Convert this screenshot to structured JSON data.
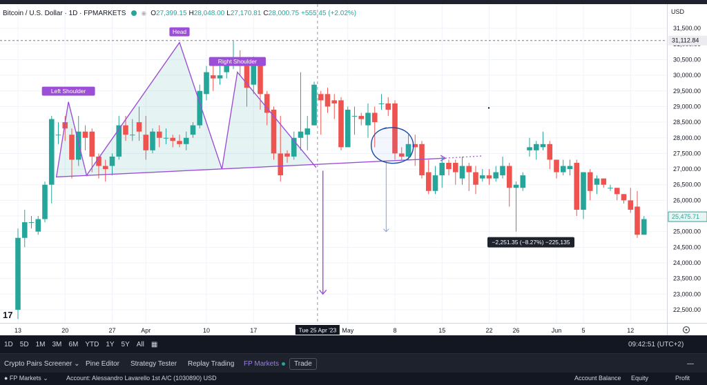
{
  "legend": {
    "symbol": "Bitcoin / U.S. Dollar · 1D · FPMARKETS",
    "open_label": "O",
    "open": "27,399.15",
    "high_label": "H",
    "high": "28,048.00",
    "low_label": "L",
    "low": "27,170.81",
    "close_label": "C",
    "close": "28,000.75",
    "change": "+555.45 (+2.02%)"
  },
  "currency": "USD",
  "price_badges": {
    "line_price": "31,112.84",
    "last_price": "25,475.71"
  },
  "measure_label": "−2,251.35 (−8.27%) −225,135",
  "crosshair_date": "Tue 25 Apr '23",
  "tv_logo": "17",
  "colors": {
    "up": "#26a69a",
    "down": "#ef5350",
    "pattern": "#9c4fd6",
    "circle": "#1848a8"
  },
  "chart_data": {
    "type": "candlestick",
    "title": "Bitcoin / U.S. Dollar · 1D · FPMARKETS",
    "y_ticks": [
      22500,
      23000,
      23500,
      24000,
      24500,
      25000,
      25500,
      26000,
      26500,
      27000,
      27500,
      28000,
      28500,
      29000,
      29500,
      30000,
      30500,
      31000,
      31500
    ],
    "y_range": [
      22300,
      32100
    ],
    "x_tick_labels": [
      {
        "label": "13",
        "i": 0
      },
      {
        "label": "20",
        "i": 7
      },
      {
        "label": "27",
        "i": 14
      },
      {
        "label": "Apr",
        "i": 19
      },
      {
        "label": "10",
        "i": 28
      },
      {
        "label": "17",
        "i": 35
      },
      {
        "label": "May",
        "i": 49
      },
      {
        "label": "8",
        "i": 56
      },
      {
        "label": "15",
        "i": 63
      },
      {
        "label": "22",
        "i": 70
      },
      {
        "label": "26",
        "i": 74
      },
      {
        "label": "Jun",
        "i": 80
      },
      {
        "label": "5",
        "i": 84
      },
      {
        "label": "12",
        "i": 91
      }
    ],
    "candles": [
      [
        22500,
        24800,
        22200,
        25100
      ],
      [
        24800,
        25300,
        24500,
        25700
      ],
      [
        25300,
        25300,
        25100,
        25500
      ],
      [
        25000,
        25400,
        24900,
        25500
      ],
      [
        25400,
        26500,
        25300,
        26600
      ],
      [
        26500,
        28600,
        25900,
        28700
      ],
      [
        28100,
        28100,
        27800,
        28500
      ],
      [
        28500,
        28300,
        27900,
        28700
      ],
      [
        28100,
        27300,
        26700,
        28300
      ],
      [
        27300,
        28200,
        27100,
        28700
      ],
      [
        28200,
        28000,
        27600,
        28400
      ],
      [
        28200,
        27400,
        26900,
        28300
      ],
      [
        27400,
        27100,
        26700,
        27500
      ],
      [
        27100,
        27000,
        26600,
        27300
      ],
      [
        27100,
        27400,
        26800,
        27500
      ],
      [
        27400,
        28400,
        27300,
        28700
      ],
      [
        28400,
        28100,
        27900,
        28700
      ],
      [
        28100,
        28100,
        27900,
        28600
      ],
      [
        28500,
        28200,
        27900,
        29000
      ],
      [
        28100,
        27600,
        27300,
        28700
      ],
      [
        27600,
        28200,
        27500,
        28300
      ],
      [
        28200,
        28000,
        27700,
        28400
      ],
      [
        28000,
        28000,
        27800,
        28300
      ],
      [
        28000,
        27900,
        27700,
        28100
      ],
      [
        27900,
        27800,
        27700,
        28100
      ],
      [
        27800,
        28000,
        27600,
        28200
      ],
      [
        28100,
        28400,
        28000,
        28500
      ],
      [
        28400,
        29500,
        28300,
        29700
      ],
      [
        29400,
        30100,
        29200,
        30300
      ],
      [
        30000,
        29900,
        29500,
        30300
      ],
      [
        29900,
        30000,
        29700,
        30400
      ],
      [
        30100,
        30400,
        29900,
        30500
      ],
      [
        30400,
        30500,
        30200,
        31100
      ],
      [
        30500,
        30300,
        30000,
        30800
      ],
      [
        30300,
        29600,
        29000,
        30500
      ],
      [
        29700,
        30500,
        29400,
        30600
      ],
      [
        30400,
        29400,
        28900,
        30500
      ],
      [
        29400,
        28800,
        28400,
        29500
      ],
      [
        28900,
        27500,
        27300,
        29000
      ],
      [
        27500,
        26800,
        26600,
        28700
      ],
      [
        27500,
        27400,
        27200,
        27600
      ],
      [
        27400,
        28000,
        27300,
        28200
      ],
      [
        28000,
        28200,
        27600,
        30100
      ],
      [
        28100,
        28300,
        27600,
        28700
      ],
      [
        28400,
        29700,
        28400,
        29800
      ],
      [
        29400,
        29200,
        28100,
        29500
      ],
      [
        29400,
        29000,
        28800,
        29600
      ],
      [
        29200,
        29100,
        28600,
        29400
      ],
      [
        29200,
        27700,
        27600,
        29300
      ],
      [
        27700,
        28900,
        27700,
        29000
      ],
      [
        28700,
        28700,
        28100,
        29000
      ],
      [
        28700,
        28600,
        28400,
        28800
      ],
      [
        28400,
        28800,
        28000,
        29100
      ],
      [
        28800,
        28500,
        27700,
        29000
      ],
      [
        29100,
        29100,
        28900,
        29400
      ],
      [
        29100,
        28900,
        28700,
        29300
      ],
      [
        29100,
        27500,
        27300,
        29200
      ],
      [
        27500,
        27400,
        27300,
        27700
      ],
      [
        27400,
        27800,
        27300,
        28100
      ],
      [
        27800,
        27700,
        27100,
        28100
      ],
      [
        27800,
        26800,
        26700,
        27900
      ],
      [
        26900,
        26300,
        26200,
        27300
      ],
      [
        26300,
        26800,
        26200,
        27100
      ],
      [
        26800,
        27200,
        26400,
        27400
      ],
      [
        27200,
        27000,
        26800,
        27300
      ],
      [
        27200,
        26900,
        26500,
        27300
      ],
      [
        26700,
        27100,
        26500,
        27400
      ],
      [
        27100,
        26900,
        26300,
        27200
      ],
      [
        26900,
        26500,
        26200,
        27100
      ],
      [
        26700,
        26800,
        26600,
        27000
      ],
      [
        26800,
        26700,
        26500,
        27000
      ],
      [
        26700,
        26900,
        26600,
        27100
      ],
      [
        26800,
        27100,
        26700,
        27400
      ],
      [
        27100,
        26400,
        25800,
        27200
      ],
      [
        26400,
        26500,
        25000,
        26600
      ],
      [
        26400,
        26800,
        26300,
        26900
      ],
      [
        27600,
        27700,
        27400,
        28000
      ],
      [
        27600,
        27800,
        27300,
        27900
      ],
      [
        27700,
        27800,
        27600,
        28200
      ],
      [
        27800,
        27300,
        27000,
        27900
      ],
      [
        27300,
        26900,
        26700,
        27000
      ],
      [
        26900,
        27100,
        26800,
        27300
      ],
      [
        27000,
        27100,
        26800,
        27300
      ],
      [
        27200,
        25700,
        25500,
        27300
      ],
      [
        25700,
        26900,
        25400,
        26900
      ],
      [
        26900,
        26300,
        26000,
        27000
      ],
      [
        26500,
        26700,
        26200,
        26800
      ],
      [
        26700,
        26500,
        26400,
        26700
      ],
      [
        26400,
        26400,
        26300,
        26500
      ],
      [
        26400,
        26200,
        26000,
        26400
      ],
      [
        26200,
        26000,
        25900,
        26200
      ],
      [
        26000,
        25700,
        25600,
        26400
      ],
      [
        25800,
        24900,
        24800,
        26300
      ],
      [
        24900,
        25400,
        24900,
        25500
      ]
    ],
    "pattern_labels": [
      "Left Shoulder",
      "Head",
      "Right Shoulder"
    ],
    "pattern_points": [
      {
        "i": 5.7,
        "p": 26730
      },
      {
        "i": 7.5,
        "p": 29150
      },
      {
        "i": 10.2,
        "p": 26800
      },
      {
        "i": 24.0,
        "p": 31050
      },
      {
        "i": 30.3,
        "p": 27000
      },
      {
        "i": 32.6,
        "p": 30100
      },
      {
        "i": 44.3,
        "p": 27050
      }
    ],
    "neckline": [
      {
        "i": 5.7,
        "p": 26750
      },
      {
        "i": 63.5,
        "p": 27350
      }
    ],
    "neckline_extension_end": {
      "i": 69.0,
      "p": 27420
    },
    "target_arrow": {
      "i": 45.3,
      "from": 26950,
      "to": 23000
    },
    "horizontal_line": 31112.84,
    "measure": {
      "i": 54.7,
      "from": 27250,
      "to": 25000
    },
    "circle": {
      "i": 56.0,
      "p": 27750
    }
  }
}
